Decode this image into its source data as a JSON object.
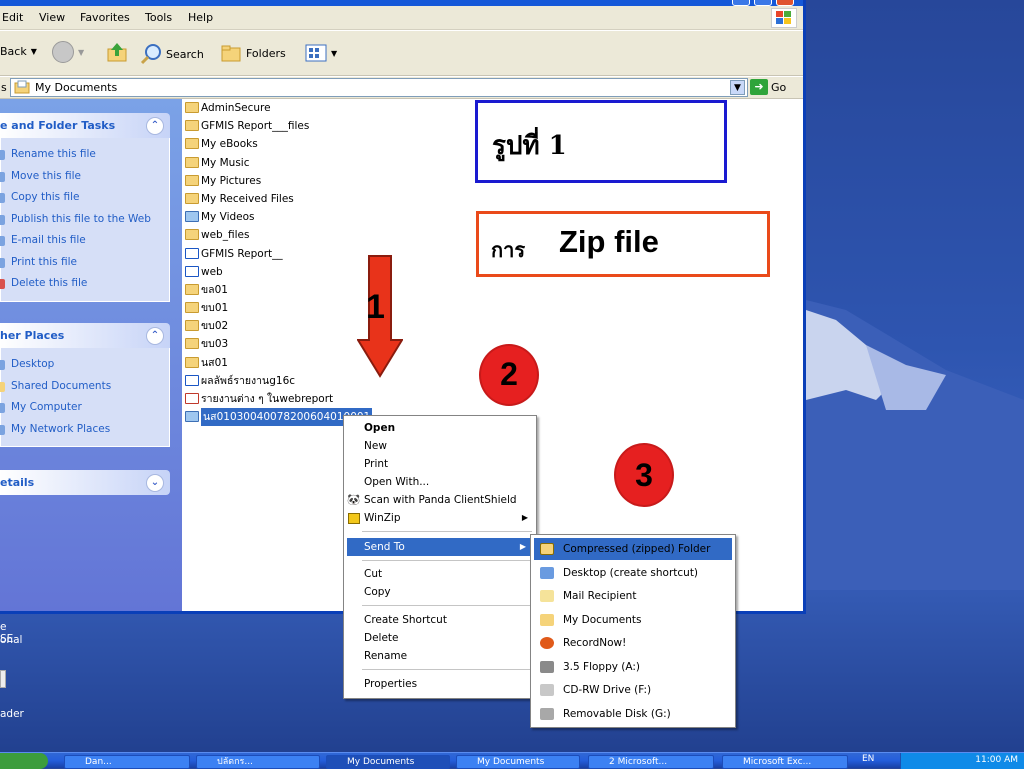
{
  "menubar": [
    "Edit",
    "View",
    "Favorites",
    "Tools",
    "Help"
  ],
  "toolbar": {
    "back": "Back",
    "search": "Search",
    "folders": "Folders"
  },
  "address": {
    "label": "s",
    "value": "My Documents",
    "go": "Go"
  },
  "tasks": {
    "file_folder": {
      "title": "e and Folder Tasks",
      "items": [
        "Rename this file",
        "Move this file",
        "Copy this file",
        "Publish this file to the Web",
        "E-mail this file",
        "Print this file",
        "Delete this file"
      ]
    },
    "other_places": {
      "title": "her Places",
      "items": [
        "Desktop",
        "Shared Documents",
        "My Computer",
        "My Network Places"
      ]
    },
    "details": {
      "title": "etails"
    }
  },
  "files": [
    {
      "name": "AdminSecure",
      "icon": "folder"
    },
    {
      "name": "GFMIS Report___files",
      "icon": "folder"
    },
    {
      "name": "My eBooks",
      "icon": "folder"
    },
    {
      "name": "My Music",
      "icon": "folder"
    },
    {
      "name": "My Pictures",
      "icon": "folder"
    },
    {
      "name": "My Received Files",
      "icon": "folder"
    },
    {
      "name": "My Videos",
      "icon": "media"
    },
    {
      "name": "web_files",
      "icon": "folder"
    },
    {
      "name": "GFMIS Report__",
      "icon": "doc"
    },
    {
      "name": "web",
      "icon": "doc"
    },
    {
      "name": "ขล01",
      "icon": "folder"
    },
    {
      "name": "ขบ01",
      "icon": "folder"
    },
    {
      "name": "ขบ02",
      "icon": "folder"
    },
    {
      "name": "ขบ03",
      "icon": "folder"
    },
    {
      "name": "นส01",
      "icon": "folder"
    },
    {
      "name": "ผลลัพธ์รายงานg16c",
      "icon": "doc"
    },
    {
      "name": "รายงานต่าง ๆ ในwebreport",
      "icon": "doc"
    },
    {
      "name": "นส01030040078200604010001",
      "icon": "media",
      "selected": true
    }
  ],
  "annotations": {
    "title_box": "รูปที่ 1",
    "zip_box_thai": "การ",
    "zip_box_en": "Zip file",
    "step1": "1",
    "step2": "2",
    "step3": "3"
  },
  "context_menu": [
    "Open",
    "New",
    "Print",
    "Open With...",
    "Scan with Panda ClientShield",
    "WinZip",
    "Send To",
    "Cut",
    "Copy",
    "Create Shortcut",
    "Delete",
    "Rename",
    "Properties"
  ],
  "send_to_menu": [
    "Compressed (zipped) Folder",
    "Desktop (create shortcut)",
    "Mail Recipient",
    "My Documents",
    "RecordNow!",
    "3.5 Floppy (A:)",
    "CD-RW Drive (F:)",
    "Removable Disk (G:)"
  ],
  "desktop_icons": {
    "a1": "e SE",
    "a2": "onal",
    "b": "ader"
  },
  "taskbar": {
    "tray_lang": "EN",
    "tray_time": "11:00 AM",
    "tasks": [
      "Dan...",
      "ปลัดกร...",
      "My Documents",
      "My Documents",
      "2 Microsoft...",
      "Microsoft Exc..."
    ]
  }
}
